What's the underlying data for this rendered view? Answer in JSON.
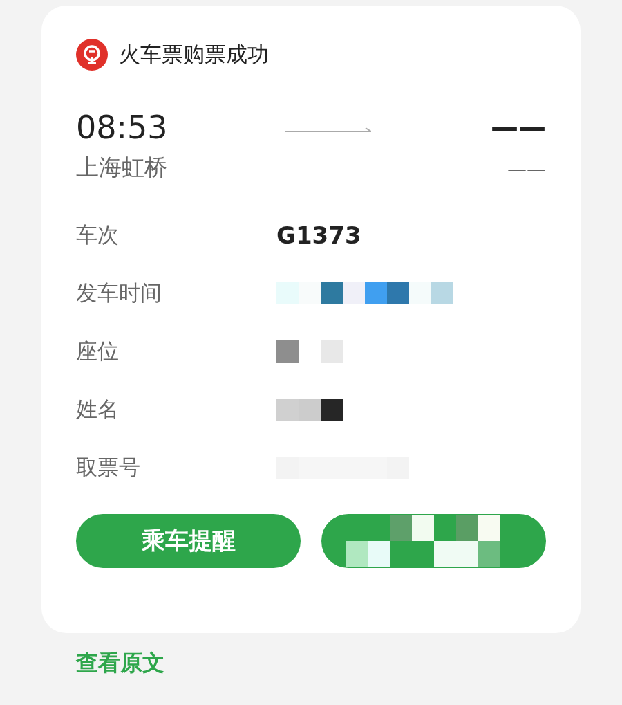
{
  "card": {
    "title": "火车票购票成功",
    "departure": {
      "time": "08:53",
      "station": "上海虹桥"
    },
    "arrival": {
      "time": "——",
      "station": "——"
    },
    "details": [
      {
        "label": "车次",
        "value": "G1373",
        "redacted": false
      },
      {
        "label": "发车时间",
        "redacted": true
      },
      {
        "label": "座位",
        "redacted": true
      },
      {
        "label": "姓名",
        "redacted": true
      },
      {
        "label": "取票号",
        "redacted": true
      }
    ],
    "buttons": [
      {
        "label": "乘车提醒",
        "redacted": false
      },
      {
        "redacted": true
      }
    ]
  },
  "link": "查看原文"
}
